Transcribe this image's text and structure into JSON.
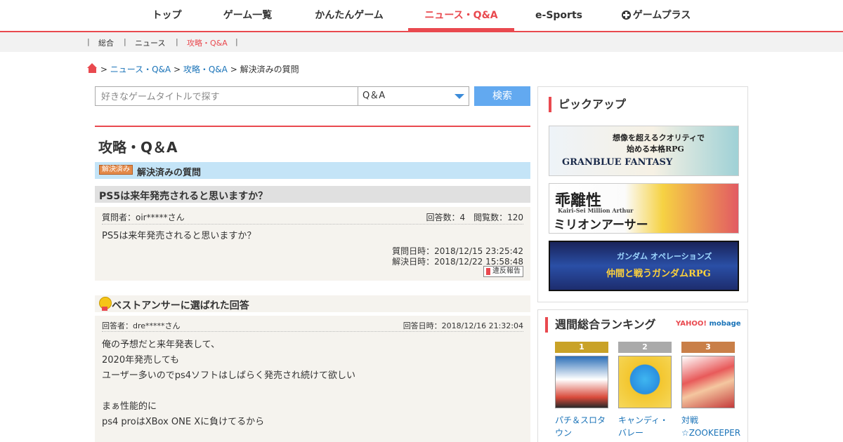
{
  "topnav": {
    "items": [
      {
        "label": "トップ"
      },
      {
        "label": "ゲーム一覧"
      },
      {
        "label": "かんたんゲーム"
      },
      {
        "label": "ニュース・Q&A"
      },
      {
        "label": "e-Sports"
      },
      {
        "label": "ゲームプラス"
      }
    ],
    "active_index": 3,
    "accent_color": "#e9494f"
  },
  "subnav": {
    "items": [
      {
        "label": "総合"
      },
      {
        "label": "ニュース"
      },
      {
        "label": "攻略・Q&A"
      }
    ],
    "separator": "|",
    "active_index": 2
  },
  "breadcrumb": {
    "home_icon": "home-icon",
    "links": [
      "ニュース・Q&A",
      "攻略・Q&A"
    ],
    "current": "解決済みの質問",
    "separator": ">"
  },
  "search": {
    "placeholder": "好きなゲームタイトルで探す",
    "value": "",
    "select_value": "Q＆A",
    "button_label": "検索"
  },
  "main": {
    "title": "攻略・Q＆A",
    "solved_badge": "解決済み",
    "solved_title": "解決済みの質問",
    "question": {
      "title": "PS5は来年発売されると思いますか？",
      "asker": "質問者：oir*****さん",
      "counts": "回答数：4　閲覧数：120",
      "body": "PS5は来年発売されると思いますか？",
      "asked_at": "質問日時：2018/12/15 23:25:42",
      "solved_at": "解決日時：2018/12/22 15:58:48",
      "report_label": "違反報告"
    },
    "best_answer": {
      "heading": "ベストアンサーに選ばれた回答",
      "answerer": "回答者：dre*****さん",
      "answered_at": "回答日時：2018/12/16 21:32:04",
      "lines": [
        "俺の予想だと来年発表して、",
        "2020年発売しても",
        "ユーザー多いのでps4ソフトはしばらく発売され続けて欲しい",
        "まぁ性能的に",
        "ps4 proはXBox ONE Xに負けてるから"
      ]
    }
  },
  "sidebar": {
    "pickup_heading": "ピックアップ",
    "banners": [
      {
        "caption_1": "想像を超えるクオリティで",
        "caption_2": "始める本格RPG",
        "logo": "GRANBLUE FANTASY"
      },
      {
        "caption_1": "乖離性",
        "caption_2": "ミリオンアーサー",
        "logo": "Kairi-Sei Million Arthur"
      },
      {
        "caption_1": "ガンダム オペレーションズ",
        "caption_2": "仲間と戦うガンダムRPG",
        "logo": ""
      }
    ],
    "ranking_heading": "週間総合ランキング",
    "ranking_brand_1": "YAHOO!",
    "ranking_brand_2": "mobage",
    "ranking": [
      {
        "rank": "1",
        "name": "パチ＆スロタウン",
        "color": "#c9a227"
      },
      {
        "rank": "2",
        "name": "キャンディ・バレー",
        "color": "#aaaaaa"
      },
      {
        "rank": "3",
        "name": "対戦☆ZOOKEEPER",
        "color": "#c97f48"
      }
    ]
  }
}
